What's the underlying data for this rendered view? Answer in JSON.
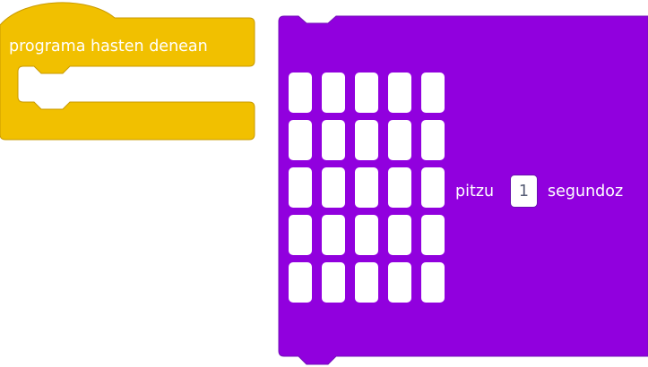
{
  "hat_block": {
    "label": "programa hasten denean",
    "color": "#f1c000",
    "border_color": "#c99a00"
  },
  "display_block": {
    "color": "#9100de",
    "border_color": "#7310b8",
    "led_rows": 5,
    "led_cols": 5,
    "text_before": "pitzu",
    "duration_value": "1",
    "text_after": "segundoz"
  }
}
